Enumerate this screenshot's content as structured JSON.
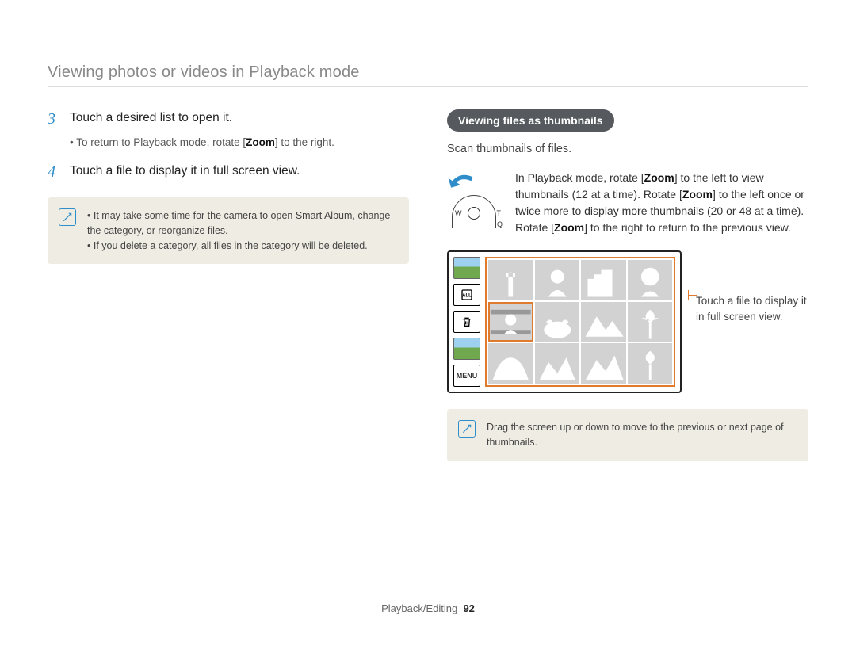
{
  "page_title": "Viewing photos or videos in Playback mode",
  "left": {
    "step3_num": "3",
    "step3_text": "Touch a desired list to open it.",
    "step3_sub_pre": "To return to Playback mode, rotate [",
    "step3_sub_bold": "Zoom",
    "step3_sub_post": "] to the right.",
    "step4_num": "4",
    "step4_text": "Touch a file to display it in full screen view.",
    "note_items": [
      "It may take some time for the camera to open Smart Album, change the category, or reorganize files.",
      "If you delete a category, all files in the category will be deleted."
    ]
  },
  "right": {
    "pill": "Viewing files as thumbnails",
    "intro": "Scan thumbnails of files.",
    "zoom_pre": "In Playback mode, rotate [",
    "zoom_b1": "Zoom",
    "zoom_mid1": "] to the left to view thumbnails (12 at a time). Rotate [",
    "zoom_b2": "Zoom",
    "zoom_mid2": "] to the left once or twice more to display more thumbnails (20 or 48 at a time). Rotate [",
    "zoom_b3": "Zoom",
    "zoom_post": "] to the right to return to the previous view.",
    "dial_w": "W",
    "dial_t": "T",
    "dial_q": "Q",
    "side_menu": "MENU",
    "side_all": "ALL",
    "callout": "Touch a file to display it in full screen view.",
    "note": "Drag the screen up or down to move to the previous or next page of thumbnails."
  },
  "footer_section": "Playback/Editing",
  "footer_page": "92",
  "icons": {
    "note": "note-icon",
    "arrow_left": "arrow-left-icon",
    "zoom_dial": "zoom-dial-icon",
    "trash": "trash-icon",
    "all_filter": "all-filter-icon",
    "thumb_photo": "photo-thumbnail-icon",
    "menu": "menu-button"
  }
}
